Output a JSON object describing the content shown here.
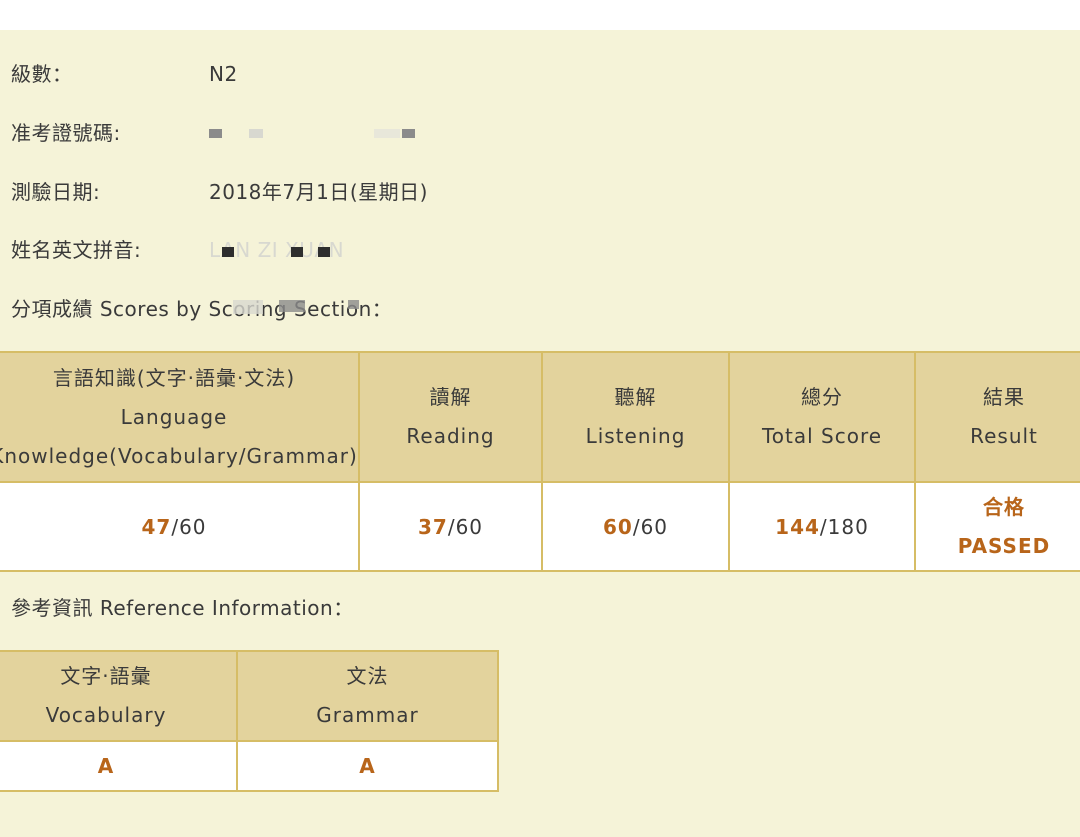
{
  "info": {
    "level_label": "級數：",
    "level_value": "N2",
    "reg_label": "准考證號碼:",
    "date_label": "測驗日期:",
    "date_value": "2018年7月1日(星期日)",
    "name_label": "姓名英文拼音:",
    "name_value": "LAN ZI XUAN"
  },
  "scores": {
    "section_title": "分項成績 Scores by Scoring Section：",
    "headers": [
      {
        "zh": "言語知識(文字·語彙·文法)",
        "en1": "Language",
        "en2": "Knowledge(Vocabulary/Grammar)"
      },
      {
        "zh": "讀解",
        "en": "Reading"
      },
      {
        "zh": "聽解",
        "en": "Listening"
      },
      {
        "zh": "總分",
        "en": "Total Score"
      },
      {
        "zh": "結果",
        "en": "Result"
      }
    ],
    "values": [
      {
        "score": "47",
        "max": "/60"
      },
      {
        "score": "37",
        "max": "/60"
      },
      {
        "score": "60",
        "max": "/60"
      },
      {
        "score": "144",
        "max": "/180"
      }
    ],
    "result": {
      "zh": "合格",
      "en": "PASSED"
    }
  },
  "reference": {
    "section_title": "參考資訊 Reference Information：",
    "headers": [
      {
        "zh": "文字·語彙",
        "en": "Vocabulary"
      },
      {
        "zh": "文法",
        "en": "Grammar"
      }
    ],
    "values": [
      "A",
      "A"
    ]
  },
  "colors": {
    "background": "#f5f3d8",
    "header_fill": "#e3d39d",
    "border": "#d6bd66",
    "accent": "#b8651a"
  }
}
